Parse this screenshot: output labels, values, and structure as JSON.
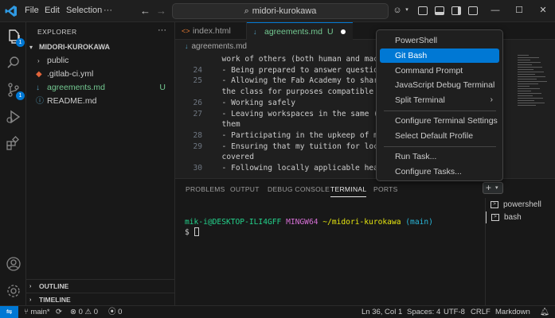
{
  "titlebar": {
    "menu": [
      "File",
      "Edit",
      "Selection",
      "···"
    ],
    "search_text": "midori-kurokawa"
  },
  "activity": {
    "explorer_badge": "1",
    "scm_badge": "1"
  },
  "sidebar": {
    "title": "EXPLORER",
    "root": "MIDORI-KUROKAWA",
    "items": [
      {
        "label": "public",
        "status": ""
      },
      {
        "label": ".gitlab-ci.yml",
        "status": ""
      },
      {
        "label": "agreements.md",
        "status": "U"
      },
      {
        "label": "README.md",
        "status": ""
      }
    ],
    "outline": "OUTLINE",
    "timeline": "TIMELINE"
  },
  "tabs": [
    {
      "label": "index.html",
      "icon": "<>"
    },
    {
      "label": "agreements.md",
      "status": "U"
    }
  ],
  "breadcrumb": "agreements.md",
  "editor": {
    "lines": [
      {
        "num": "",
        "text": "  work of others (both human and machin"
      },
      {
        "num": "24",
        "text": "  - Being prepared to answer questions"
      },
      {
        "num": "25",
        "text": "  - Allowing the Fab Academy to share m"
      },
      {
        "num": "",
        "text": "  the class for purposes compatible wit"
      },
      {
        "num": "26",
        "text": "  - Working safely"
      },
      {
        "num": "27",
        "text": "  - Leaving workspaces in the same (or                             nd"
      },
      {
        "num": "",
        "text": "  them"
      },
      {
        "num": "28",
        "text": "  - Participating in the upkeep of my l"
      },
      {
        "num": "29",
        "text": "  - Ensuring that my tuition for local"
      },
      {
        "num": "",
        "text": "  covered"
      },
      {
        "num": "30",
        "text": "  - Following locally applicable health"
      }
    ]
  },
  "panel": {
    "tabs": [
      "PROBLEMS",
      "OUTPUT",
      "DEBUG CONSOLE",
      "TERMINAL",
      "PORTS"
    ],
    "active_tab": "TERMINAL",
    "terminal": {
      "user": "mik-i@DESKTOP-ILI4GFF",
      "env": "MINGW64",
      "path": "~/midori-kurokawa",
      "branch": "(main)",
      "prompt": "$"
    },
    "terminals": [
      "powershell",
      "bash"
    ]
  },
  "dropdown": {
    "items": [
      {
        "label": "PowerShell"
      },
      {
        "label": "Git Bash",
        "highlighted": true
      },
      {
        "label": "Command Prompt"
      },
      {
        "label": "JavaScript Debug Terminal"
      },
      {
        "label": "Split Terminal",
        "submenu": true
      },
      {
        "label": "Configure Terminal Settings"
      },
      {
        "label": "Select Default Profile"
      },
      {
        "label": "Run Task..."
      },
      {
        "label": "Configure Tasks..."
      }
    ]
  },
  "statusbar": {
    "branch": "main*",
    "errors": "0",
    "warnings": "0",
    "ports": "0",
    "position": "Ln 36, Col 1",
    "spaces": "Spaces: 4",
    "encoding": "UTF-8",
    "eol": "CRLF",
    "language": "Markdown"
  },
  "colors": {
    "accent": "#0078d4",
    "untracked": "#73c991"
  }
}
